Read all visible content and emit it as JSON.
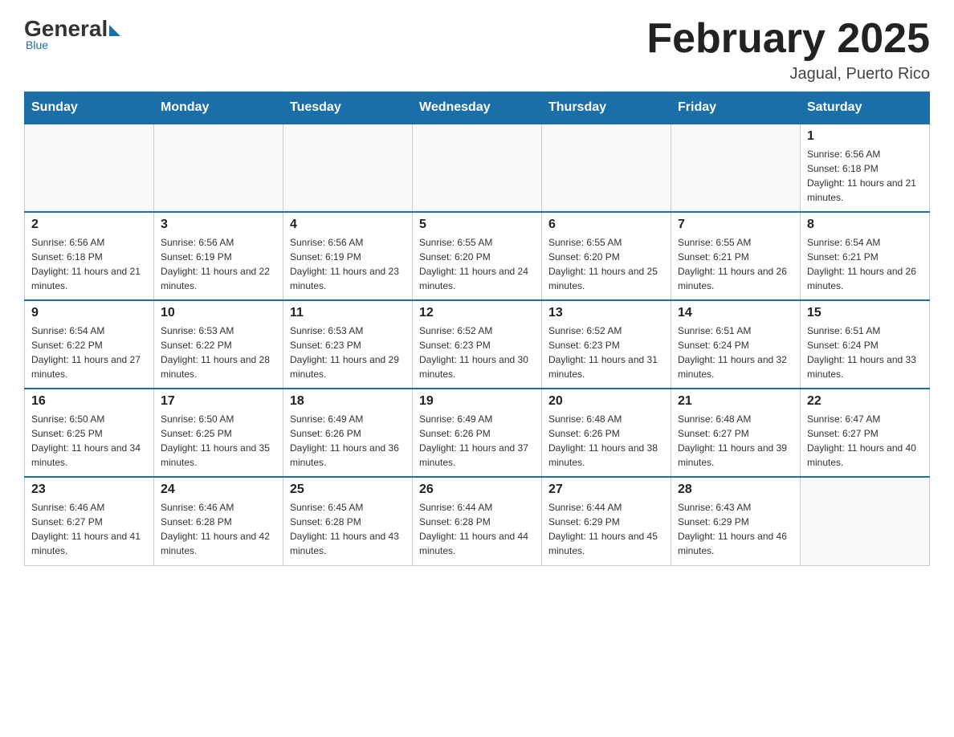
{
  "logo": {
    "general": "General",
    "blue": "Blue",
    "sub": "Blue"
  },
  "header": {
    "month_title": "February 2025",
    "location": "Jagual, Puerto Rico"
  },
  "days_of_week": [
    "Sunday",
    "Monday",
    "Tuesday",
    "Wednesday",
    "Thursday",
    "Friday",
    "Saturday"
  ],
  "weeks": [
    [
      {
        "day": "",
        "info": ""
      },
      {
        "day": "",
        "info": ""
      },
      {
        "day": "",
        "info": ""
      },
      {
        "day": "",
        "info": ""
      },
      {
        "day": "",
        "info": ""
      },
      {
        "day": "",
        "info": ""
      },
      {
        "day": "1",
        "info": "Sunrise: 6:56 AM\nSunset: 6:18 PM\nDaylight: 11 hours and 21 minutes."
      }
    ],
    [
      {
        "day": "2",
        "info": "Sunrise: 6:56 AM\nSunset: 6:18 PM\nDaylight: 11 hours and 21 minutes."
      },
      {
        "day": "3",
        "info": "Sunrise: 6:56 AM\nSunset: 6:19 PM\nDaylight: 11 hours and 22 minutes."
      },
      {
        "day": "4",
        "info": "Sunrise: 6:56 AM\nSunset: 6:19 PM\nDaylight: 11 hours and 23 minutes."
      },
      {
        "day": "5",
        "info": "Sunrise: 6:55 AM\nSunset: 6:20 PM\nDaylight: 11 hours and 24 minutes."
      },
      {
        "day": "6",
        "info": "Sunrise: 6:55 AM\nSunset: 6:20 PM\nDaylight: 11 hours and 25 minutes."
      },
      {
        "day": "7",
        "info": "Sunrise: 6:55 AM\nSunset: 6:21 PM\nDaylight: 11 hours and 26 minutes."
      },
      {
        "day": "8",
        "info": "Sunrise: 6:54 AM\nSunset: 6:21 PM\nDaylight: 11 hours and 26 minutes."
      }
    ],
    [
      {
        "day": "9",
        "info": "Sunrise: 6:54 AM\nSunset: 6:22 PM\nDaylight: 11 hours and 27 minutes."
      },
      {
        "day": "10",
        "info": "Sunrise: 6:53 AM\nSunset: 6:22 PM\nDaylight: 11 hours and 28 minutes."
      },
      {
        "day": "11",
        "info": "Sunrise: 6:53 AM\nSunset: 6:23 PM\nDaylight: 11 hours and 29 minutes."
      },
      {
        "day": "12",
        "info": "Sunrise: 6:52 AM\nSunset: 6:23 PM\nDaylight: 11 hours and 30 minutes."
      },
      {
        "day": "13",
        "info": "Sunrise: 6:52 AM\nSunset: 6:23 PM\nDaylight: 11 hours and 31 minutes."
      },
      {
        "day": "14",
        "info": "Sunrise: 6:51 AM\nSunset: 6:24 PM\nDaylight: 11 hours and 32 minutes."
      },
      {
        "day": "15",
        "info": "Sunrise: 6:51 AM\nSunset: 6:24 PM\nDaylight: 11 hours and 33 minutes."
      }
    ],
    [
      {
        "day": "16",
        "info": "Sunrise: 6:50 AM\nSunset: 6:25 PM\nDaylight: 11 hours and 34 minutes."
      },
      {
        "day": "17",
        "info": "Sunrise: 6:50 AM\nSunset: 6:25 PM\nDaylight: 11 hours and 35 minutes."
      },
      {
        "day": "18",
        "info": "Sunrise: 6:49 AM\nSunset: 6:26 PM\nDaylight: 11 hours and 36 minutes."
      },
      {
        "day": "19",
        "info": "Sunrise: 6:49 AM\nSunset: 6:26 PM\nDaylight: 11 hours and 37 minutes."
      },
      {
        "day": "20",
        "info": "Sunrise: 6:48 AM\nSunset: 6:26 PM\nDaylight: 11 hours and 38 minutes."
      },
      {
        "day": "21",
        "info": "Sunrise: 6:48 AM\nSunset: 6:27 PM\nDaylight: 11 hours and 39 minutes."
      },
      {
        "day": "22",
        "info": "Sunrise: 6:47 AM\nSunset: 6:27 PM\nDaylight: 11 hours and 40 minutes."
      }
    ],
    [
      {
        "day": "23",
        "info": "Sunrise: 6:46 AM\nSunset: 6:27 PM\nDaylight: 11 hours and 41 minutes."
      },
      {
        "day": "24",
        "info": "Sunrise: 6:46 AM\nSunset: 6:28 PM\nDaylight: 11 hours and 42 minutes."
      },
      {
        "day": "25",
        "info": "Sunrise: 6:45 AM\nSunset: 6:28 PM\nDaylight: 11 hours and 43 minutes."
      },
      {
        "day": "26",
        "info": "Sunrise: 6:44 AM\nSunset: 6:28 PM\nDaylight: 11 hours and 44 minutes."
      },
      {
        "day": "27",
        "info": "Sunrise: 6:44 AM\nSunset: 6:29 PM\nDaylight: 11 hours and 45 minutes."
      },
      {
        "day": "28",
        "info": "Sunrise: 6:43 AM\nSunset: 6:29 PM\nDaylight: 11 hours and 46 minutes."
      },
      {
        "day": "",
        "info": ""
      }
    ]
  ]
}
